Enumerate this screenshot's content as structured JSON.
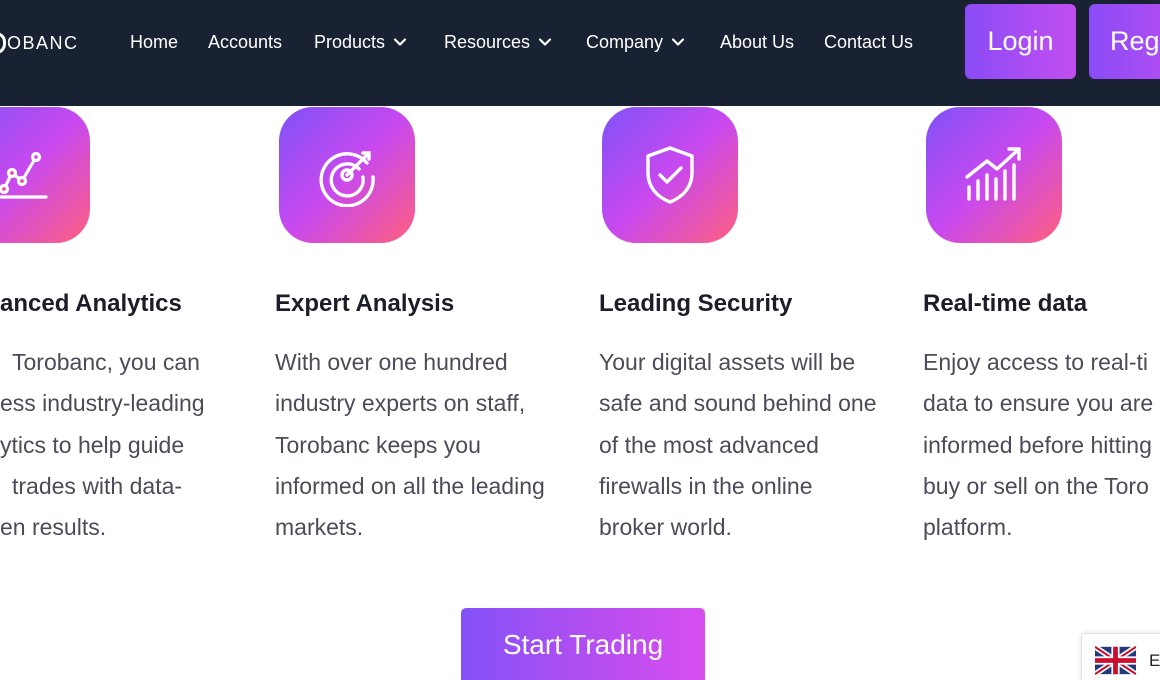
{
  "header": {
    "logo_text": "OBANC",
    "nav": [
      {
        "label": "Home"
      },
      {
        "label": "Accounts"
      },
      {
        "label": "Products"
      },
      {
        "label": "Resources"
      },
      {
        "label": "Company"
      },
      {
        "label": "About Us"
      },
      {
        "label": "Contact Us"
      }
    ],
    "login_label": "Login",
    "register_label": "Reg"
  },
  "features": [
    {
      "icon": "analytics-chart-icon",
      "title": "anced Analytics",
      "lines": [
        "Torobanc, you can",
        "ess industry-leading",
        "ytics to help guide",
        "trades with data-",
        "en results."
      ]
    },
    {
      "icon": "radar-target-icon",
      "title": "Expert Analysis",
      "lines": [
        "With over one hundred",
        "industry experts on staff,",
        "Torobanc keeps you",
        "informed on all the leading",
        "markets."
      ]
    },
    {
      "icon": "shield-check-icon",
      "title": "Leading Security",
      "lines": [
        "Your digital assets will be",
        "safe and sound behind one",
        "of the most advanced",
        "firewalls in the online",
        "broker world."
      ]
    },
    {
      "icon": "growth-bars-icon",
      "title": "Real-time data",
      "lines": [
        "Enjoy access to real-ti",
        "data to ensure you are",
        "informed before hitting",
        "buy or sell on the Toro",
        "platform."
      ]
    }
  ],
  "cta": {
    "label": "Start Trading"
  },
  "language": {
    "code": "E",
    "flag": "uk-flag-icon"
  },
  "colors": {
    "header_bg": "#182233",
    "accent_start": "#8451f8",
    "accent_end": "#d74ef0",
    "icon_warm": "#ff5f7e"
  }
}
